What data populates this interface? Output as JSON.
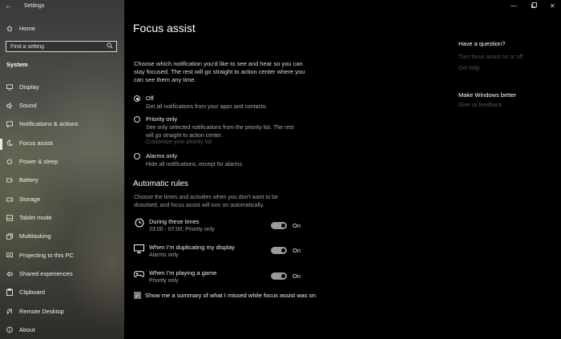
{
  "window": {
    "title": "Settings"
  },
  "sidebar": {
    "home_label": "Home",
    "search_placeholder": "Find a setting",
    "section_label": "System",
    "items": [
      {
        "label": "Display",
        "icon": "display-icon"
      },
      {
        "label": "Sound",
        "icon": "speaker-icon"
      },
      {
        "label": "Notifications & actions",
        "icon": "notifications-icon"
      },
      {
        "label": "Focus assist",
        "icon": "moon-icon"
      },
      {
        "label": "Power & sleep",
        "icon": "power-icon"
      },
      {
        "label": "Battery",
        "icon": "battery-icon"
      },
      {
        "label": "Storage",
        "icon": "storage-icon"
      },
      {
        "label": "Tablet mode",
        "icon": "tablet-icon"
      },
      {
        "label": "Multitasking",
        "icon": "multitasking-icon"
      },
      {
        "label": "Projecting to this PC",
        "icon": "projector-icon"
      },
      {
        "label": "Shared experiences",
        "icon": "shared-icon"
      },
      {
        "label": "Clipboard",
        "icon": "clipboard-icon"
      },
      {
        "label": "Remote Desktop",
        "icon": "remote-desktop-icon"
      },
      {
        "label": "About",
        "icon": "info-icon"
      }
    ],
    "active_item": "Focus assist"
  },
  "main": {
    "title": "Focus assist",
    "intro": "Choose which notification you'd like to see and hear so you can stay focused. The rest will go straight to action center where you can see them any time.",
    "options": [
      {
        "label": "Off",
        "description": "Get all notifications from your apps and contacts.",
        "selected": true
      },
      {
        "label": "Priority only",
        "description": "See only selected notifications from the priority list. The rest will go straight to action center.",
        "link": "Customize your priority list",
        "selected": false
      },
      {
        "label": "Alarms only",
        "description": "Hide all notifications, except for alarms.",
        "selected": false
      }
    ],
    "rules_title": "Automatic rules",
    "rules_intro": "Choose the times and activities when you don't want to be disturbed, and focus assist will turn on automatically.",
    "rules": [
      {
        "label": "During these times",
        "description": "23:00 - 07:00; Priority only",
        "state": "On",
        "icon": "clock-icon"
      },
      {
        "label": "When I'm duplicating my display",
        "description": "Alarms only",
        "state": "On",
        "icon": "monitor-icon"
      },
      {
        "label": "When I'm playing a game",
        "description": "Priority only",
        "state": "On",
        "icon": "gamepad-icon"
      }
    ],
    "summary_checkbox": {
      "label": "Show me a summary of what I missed while focus assist was on",
      "checked": true
    }
  },
  "help": {
    "question_title": "Have a question?",
    "links": [
      "Turn focus assist on or off",
      "Get help"
    ],
    "better_title": "Make Windows better",
    "feedback_link": "Give us feedback"
  }
}
